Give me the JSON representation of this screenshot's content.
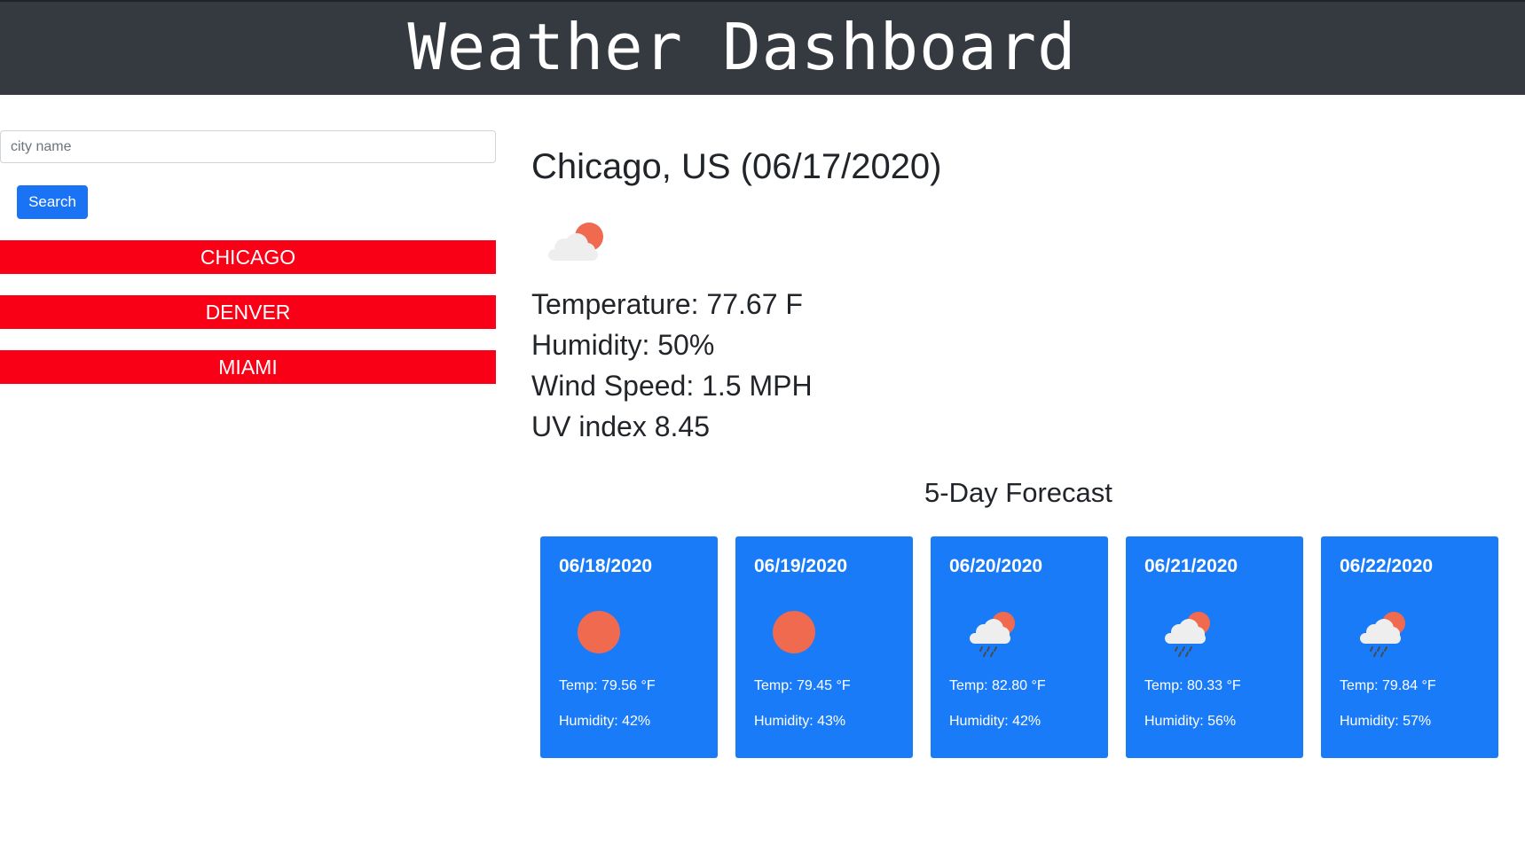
{
  "header": {
    "title": "Weather Dashboard"
  },
  "search": {
    "placeholder": "city name",
    "value": "",
    "button_label": "Search"
  },
  "history": [
    {
      "label": "CHICAGO"
    },
    {
      "label": "DENVER"
    },
    {
      "label": "MIAMI"
    }
  ],
  "current": {
    "title": "Chicago, US (06/17/2020)",
    "icon": "partly-cloudy-icon",
    "temperature": "Temperature: 77.67 F",
    "humidity": "Humidity: 50%",
    "wind": "Wind Speed: 1.5 MPH",
    "uv": "UV index 8.45"
  },
  "forecast": {
    "title": "5-Day Forecast",
    "days": [
      {
        "date": "06/18/2020",
        "icon": "sun-icon",
        "temp": "Temp: 79.56 °F",
        "humidity": "Humidity: 42%"
      },
      {
        "date": "06/19/2020",
        "icon": "sun-icon",
        "temp": "Temp: 79.45 °F",
        "humidity": "Humidity: 43%"
      },
      {
        "date": "06/20/2020",
        "icon": "rain-cloud-sun-icon",
        "temp": "Temp: 82.80 °F",
        "humidity": "Humidity: 42%"
      },
      {
        "date": "06/21/2020",
        "icon": "rain-cloud-sun-icon",
        "temp": "Temp: 80.33 °F",
        "humidity": "Humidity: 56%"
      },
      {
        "date": "06/22/2020",
        "icon": "rain-cloud-sun-icon",
        "temp": "Temp: 79.84 °F",
        "humidity": "Humidity: 57%"
      }
    ]
  },
  "colors": {
    "header_bg": "#343a40",
    "primary": "#1a7bf8",
    "history_bg": "#fa0017",
    "sun": "#ef6a4f",
    "cloud": "#eeeeee"
  }
}
